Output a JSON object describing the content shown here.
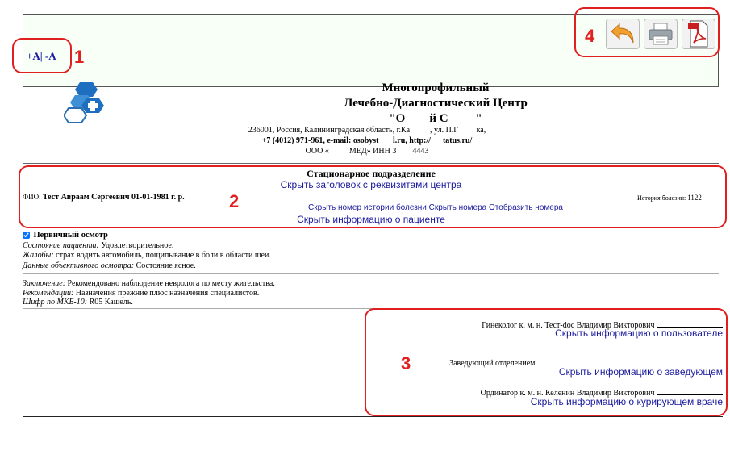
{
  "annotations": {
    "n1": "1",
    "n2": "2",
    "n3": "3",
    "n4": "4"
  },
  "toolbar": {
    "font_increase": "+A",
    "font_sep": "|",
    "font_decrease": "-A",
    "icons": [
      "back-arrow-icon",
      "printer-icon",
      "pdf-icon"
    ]
  },
  "org": {
    "name_line1": "Многопрофильный",
    "name_line2": "Лечебно-Диагностический Центр",
    "name_line3": "\"О        й С         \"",
    "address": "236001, Россия, Калининградская область, г.Ка          , ул. П.Г         ка,",
    "phone": "+7 (4012) 971-961, e-mail: osobyst       l.ru, http://      tatus.ru/",
    "inn": "ООО «          МЕД» ИНН 3        4443"
  },
  "header": {
    "department": "Стационарное подразделение",
    "hide_header_link": "Скрыть заголовок с реквизитами центра",
    "fio_label": "ФИО:",
    "fio_value": "Тест Авраам Сергеевич 01-01-1981 г. р.",
    "history_label": "История болезни:",
    "history_value": "1122",
    "hide_history_number": "Скрыть номер истории болезни",
    "hide_numbers": "Скрыть номера",
    "show_number": "Отобразить номера",
    "hide_patient_info": "Скрыть информацию о пациенте"
  },
  "exam": {
    "title": "Первичный осмотр",
    "state_label": "Состояние пациента:",
    "state_value": "Удовлетворительное.",
    "complaints_label": "Жалобы:",
    "complaints_value": "страх водить автомобиль, пощипывание в боли в области шеи.",
    "objective_label": "Данные объективного осмотра:",
    "objective_value": "Состояние ясное.",
    "conclusion_label": "Заключение:",
    "conclusion_value": "Рекомендовано наблюдение невролога по месту жительства.",
    "recommend_label": "Рекомендации:",
    "recommend_value": "Назначения прежние плюс назначения специалистов.",
    "icd_label": "Шифр по МКБ-10:",
    "icd_value": "R05 Кашель."
  },
  "signatures": {
    "doctor": "Гинеколог к. м. н. Тест-doc Владимир Викторович",
    "hide_user_info": "Скрыть информацию о пользователе",
    "head": "Заведующий отделением",
    "hide_head_info": "Скрыть информацию о заведующем",
    "resident": "Ординатор к. м. н. Келенин Владимир Викторович",
    "hide_curator_info": "Скрыть информацию о курирующем враче"
  }
}
